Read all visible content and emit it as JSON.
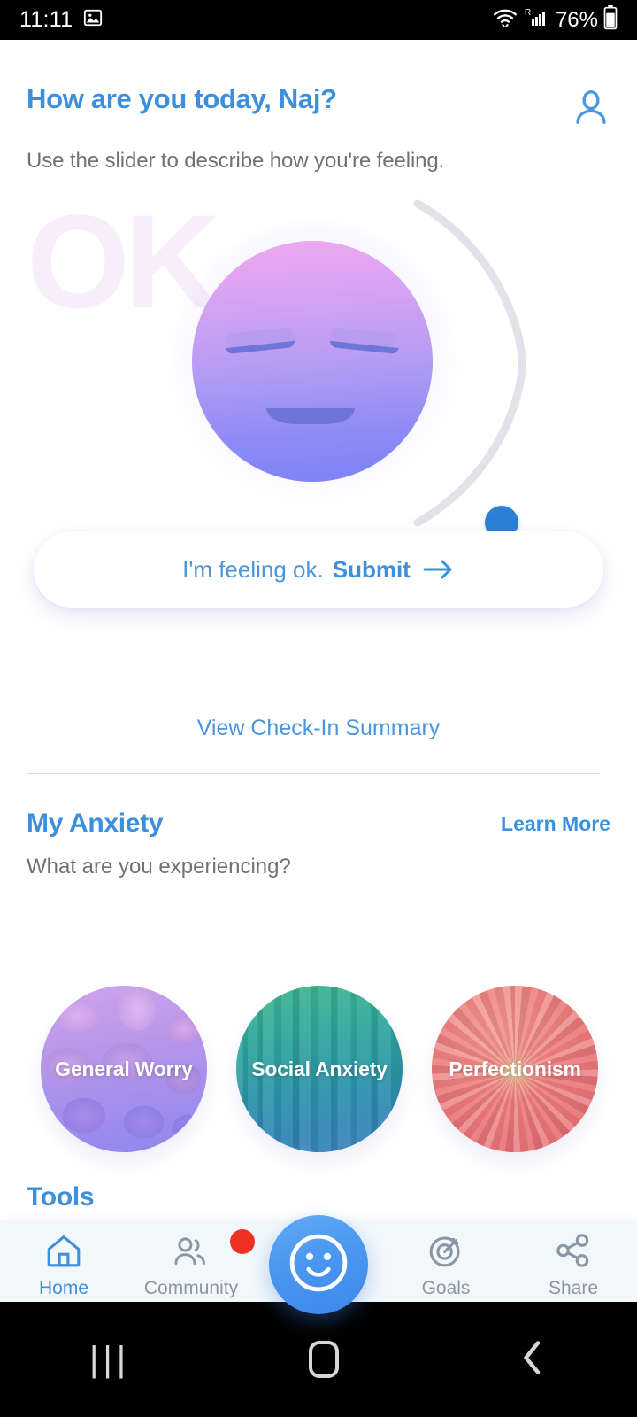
{
  "status_bar": {
    "time": "11:11",
    "image_icon": "image-icon",
    "wifi_icon": "wifi-icon",
    "signal_icon": "signal-roaming-icon",
    "battery_percent": "76%",
    "battery_icon": "battery-icon"
  },
  "header": {
    "greeting": "How are you today, Naj?",
    "subtitle": "Use the slider to describe how you're feeling.",
    "avatar_icon": "profile-avatar-icon"
  },
  "mood": {
    "watermark": "OK",
    "face_icon": "calm-face-icon",
    "slider_handle_icon": "slider-handle",
    "submit_lead": "I'm feeling ok.",
    "submit_strong": "Submit",
    "submit_arrow": "arrow-right-icon",
    "summary_link": "View Check-In Summary"
  },
  "anxiety": {
    "title": "My Anxiety",
    "learn_more": "Learn More",
    "question": "What are you experiencing?",
    "cards": [
      {
        "label": "General Worry",
        "texture": "pebbles"
      },
      {
        "label": "Social Anxiety",
        "texture": "forest"
      },
      {
        "label": "Perfectionism",
        "texture": "flower"
      }
    ]
  },
  "tools": {
    "title": "Tools"
  },
  "tabbar": {
    "items": [
      {
        "label": "Home",
        "icon": "home-icon",
        "active": true,
        "badge": false
      },
      {
        "label": "Community",
        "icon": "people-icon",
        "active": false,
        "badge": true
      },
      {
        "label": "",
        "icon": "smiley-face-icon",
        "active": false,
        "badge": false
      },
      {
        "label": "Goals",
        "icon": "target-icon",
        "active": false,
        "badge": false
      },
      {
        "label": "Share",
        "icon": "share-icon",
        "active": false,
        "badge": false
      }
    ]
  },
  "android_nav": {
    "recents": "|||",
    "home_icon": "nav-home-icon",
    "back_icon": "nav-back-icon"
  },
  "colors": {
    "accent_blue": "#3c8fdc",
    "muted_text": "#6f7175",
    "badge_red": "#ee3124",
    "tabbar_bg": "#f2f7fa",
    "arc_track": "#e2e2e8",
    "handle_blue": "#2b7fd4"
  }
}
